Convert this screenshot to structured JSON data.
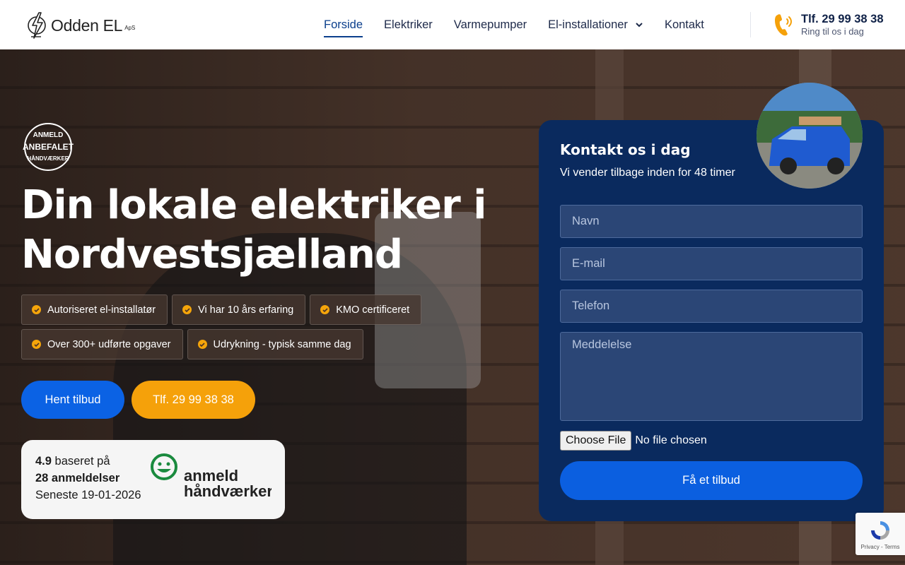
{
  "brand": {
    "name": "Odden EL",
    "suffix": "ApS"
  },
  "nav": {
    "items": [
      {
        "label": "Forside"
      },
      {
        "label": "Elektriker"
      },
      {
        "label": "Varmepumper"
      },
      {
        "label": "El-installationer"
      },
      {
        "label": "Kontakt"
      }
    ]
  },
  "header_phone": {
    "number": "Tlf. 29 99 38 38",
    "sub": "Ring til os i dag"
  },
  "hero": {
    "badge_top": "ANMELD",
    "badge_mid": "ANBEFALET",
    "badge_bottom": "HÅNDVÆRKER",
    "title_line1": "Din lokale elektriker  i",
    "title_line2": "Nordvestsjælland",
    "features": [
      "Autoriseret el-installatør",
      "Vi har 10 års erfaring",
      "KMO certificeret",
      "Over 300+ udførte opgaver",
      "Udrykning - typisk samme dag"
    ],
    "btn_quote": "Hent tilbud",
    "btn_phone": "Tlf. 29 99 38 38"
  },
  "rating": {
    "score": "4.9",
    "score_suffix": " baseret på",
    "reviews": "28 anmeldelser",
    "latest": "Seneste 19-01-2026",
    "logo_line1": "anmeld",
    "logo_line2": "håndværker"
  },
  "form": {
    "title": "Kontakt os i dag",
    "subtitle": "Vi vender tilbage inden for 48 timer",
    "name_placeholder": "Navn",
    "email_placeholder": "E-mail",
    "phone_placeholder": "Telefon",
    "message_placeholder": "Meddelelse",
    "file_button": "Choose File",
    "file_status": "No file chosen",
    "submit": "Få et tilbud"
  },
  "recaptcha": {
    "links": "Privacy - Terms"
  },
  "colors": {
    "primary_blue": "#0b62e4",
    "accent_orange": "#f5a10a",
    "navy": "#0a2a5e",
    "anmeld_green": "#1a8a3e"
  }
}
